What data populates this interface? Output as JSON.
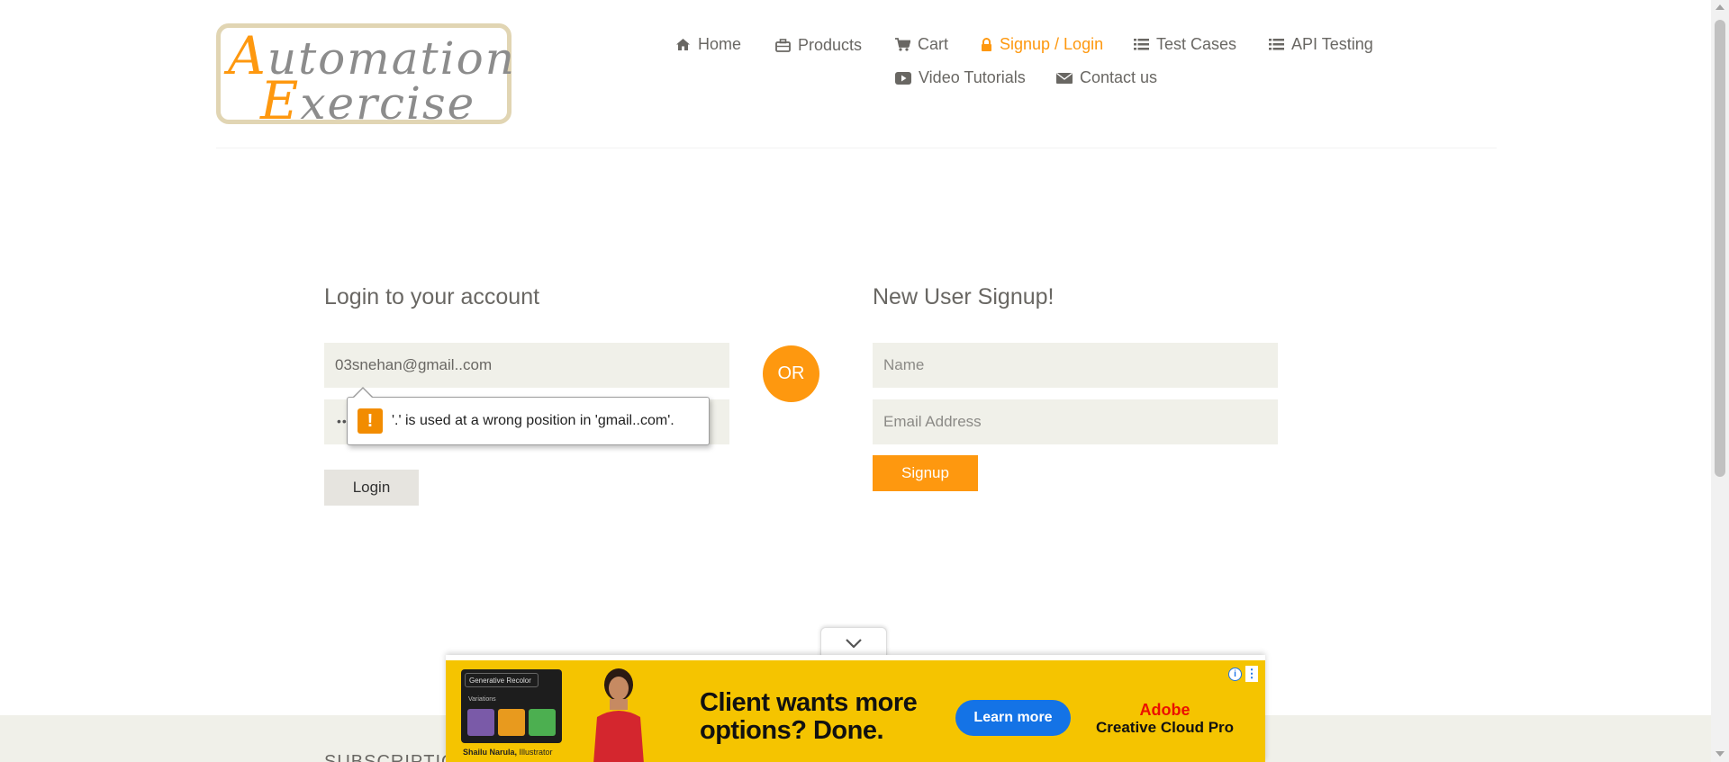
{
  "logo": {
    "line1_cap": "A",
    "line1_rest": "utomation",
    "line2_cap": "E",
    "line2_rest": "xercise"
  },
  "nav": [
    {
      "label": "Home",
      "icon": "home-icon"
    },
    {
      "label": "Products",
      "icon": "briefcase-icon"
    },
    {
      "label": "Cart",
      "icon": "shopping-cart-icon"
    },
    {
      "label": "Signup / Login",
      "icon": "lock-icon",
      "active": true
    },
    {
      "label": "Test Cases",
      "icon": "list-icon"
    },
    {
      "label": "API Testing",
      "icon": "list-icon"
    },
    {
      "label": "Video Tutorials",
      "icon": "youtube-play-icon"
    },
    {
      "label": "Contact us",
      "icon": "envelope-icon"
    }
  ],
  "colors": {
    "accent": "#fe980f",
    "field_bg": "#f0f0e9",
    "text": "#696763"
  },
  "login": {
    "title": "Login to your account",
    "email_value": "03snehan@gmail..com",
    "password_mask": "••",
    "button": "Login",
    "validation_message": "'.' is used at a wrong position in 'gmail..com'."
  },
  "divider": {
    "or_label": "OR"
  },
  "signup": {
    "title": "New User Signup!",
    "name_placeholder": "Name",
    "email_placeholder": "Email Address",
    "button": "Signup"
  },
  "footer": {
    "subscription_heading": "SUBSCRIPTION"
  },
  "ad": {
    "panel_badge": "Generative Recolor",
    "panel_label": "Variations",
    "caption_name": "Shailu Narula,",
    "caption_role": "Illustrator",
    "headline_line1": "Client wants more",
    "headline_line2": "options? Done.",
    "cta": "Learn more",
    "brand_name": "Adobe",
    "brand_product": "Creative Cloud Pro",
    "info_icon": "info-icon",
    "menu_icon": "vertical-dots-icon",
    "collapse_icon": "chevron-down-icon"
  }
}
